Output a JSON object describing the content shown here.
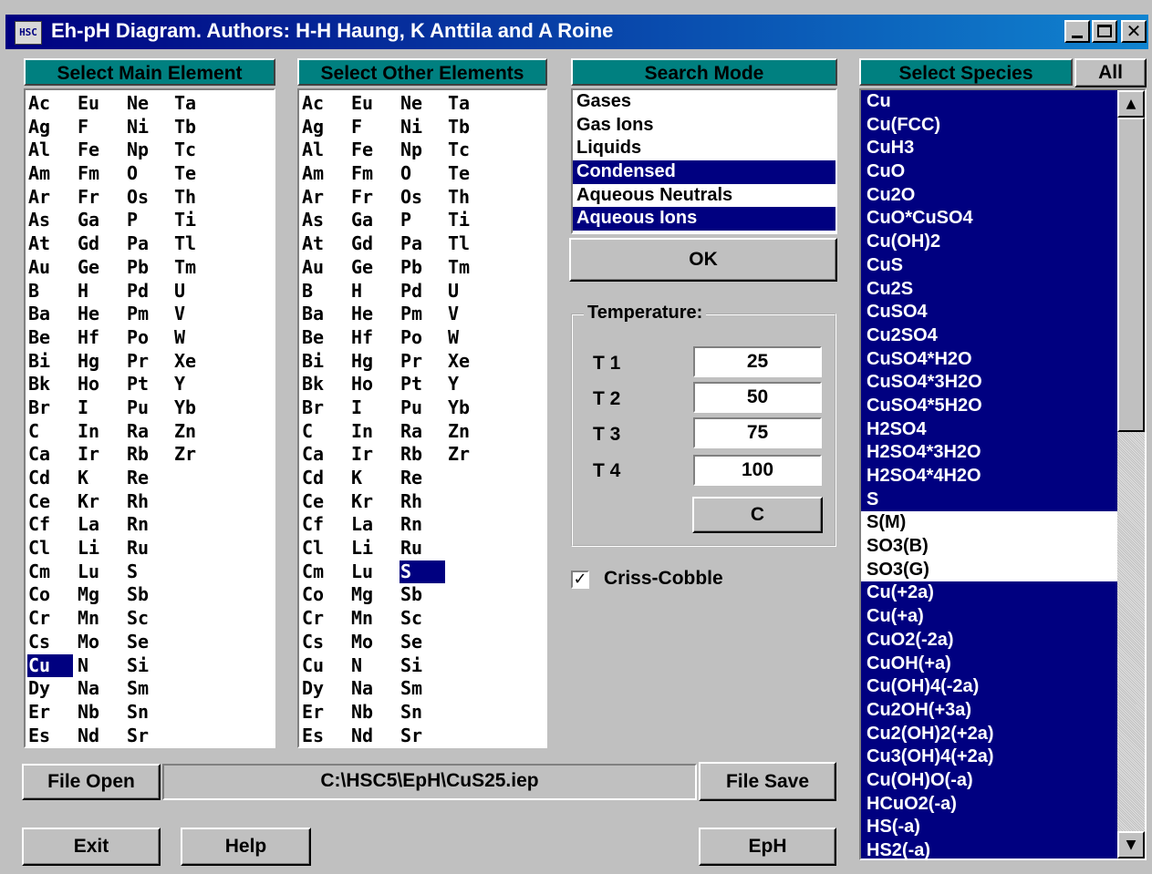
{
  "window": {
    "title": "Eh-pH Diagram. Authors: H-H Haung, K Anttila and A Roine",
    "icon_text": "HSC"
  },
  "headers": {
    "main_element": "Select Main Element",
    "other_elements": "Select Other Elements",
    "search_mode": "Search Mode",
    "species": "Select Species",
    "all_button": "All"
  },
  "elements": {
    "columns": [
      [
        "Ac",
        "Ag",
        "Al",
        "Am",
        "Ar",
        "As",
        "At",
        "Au",
        "B",
        "Ba",
        "Be",
        "Bi",
        "Bk",
        "Br",
        "C",
        "Ca",
        "Cd",
        "Ce",
        "Cf",
        "Cl",
        "Cm",
        "Co",
        "Cr",
        "Cs",
        "Cu",
        "Dy",
        "Er",
        "Es"
      ],
      [
        "Eu",
        "F",
        "Fe",
        "Fm",
        "Fr",
        "Ga",
        "Gd",
        "Ge",
        "H",
        "He",
        "Hf",
        "Hg",
        "Ho",
        "I",
        "In",
        "Ir",
        "K",
        "Kr",
        "La",
        "Li",
        "Lu",
        "Mg",
        "Mn",
        "Mo",
        "N",
        "Na",
        "Nb",
        "Nd"
      ],
      [
        "Ne",
        "Ni",
        "Np",
        "O",
        "Os",
        "P",
        "Pa",
        "Pb",
        "Pd",
        "Pm",
        "Po",
        "Pr",
        "Pt",
        "Pu",
        "Ra",
        "Rb",
        "Re",
        "Rh",
        "Rn",
        "Ru",
        "S",
        "Sb",
        "Sc",
        "Se",
        "Si",
        "Sm",
        "Sn",
        "Sr"
      ],
      [
        "Ta",
        "Tb",
        "Tc",
        "Te",
        "Th",
        "Ti",
        "Tl",
        "Tm",
        "U",
        "V",
        "W",
        "Xe",
        "Y",
        "Yb",
        "Zn",
        "Zr"
      ]
    ],
    "main_selected": "Cu",
    "other_selected": [
      "S"
    ]
  },
  "search_mode": {
    "items": [
      {
        "label": "Gases",
        "selected": false
      },
      {
        "label": "Gas Ions",
        "selected": false
      },
      {
        "label": "Liquids",
        "selected": false
      },
      {
        "label": "Condensed",
        "selected": true
      },
      {
        "label": "Aqueous Neutrals",
        "selected": false
      },
      {
        "label": "Aqueous Ions",
        "selected": true
      }
    ],
    "ok_label": "OK"
  },
  "temperature": {
    "label": "Temperature:",
    "rows": [
      {
        "label": "T 1",
        "value": "25"
      },
      {
        "label": "T 2",
        "value": "50"
      },
      {
        "label": "T 3",
        "value": "75"
      },
      {
        "label": "T 4",
        "value": "100"
      }
    ],
    "unit_button": "C"
  },
  "criss_cobble": {
    "label": "Criss-Cobble",
    "checked": true
  },
  "species": [
    {
      "label": "Cu",
      "selected": true
    },
    {
      "label": "Cu(FCC)",
      "selected": true
    },
    {
      "label": "CuH3",
      "selected": true
    },
    {
      "label": "CuO",
      "selected": true
    },
    {
      "label": "Cu2O",
      "selected": true
    },
    {
      "label": "CuO*CuSO4",
      "selected": true
    },
    {
      "label": "Cu(OH)2",
      "selected": true
    },
    {
      "label": "CuS",
      "selected": true
    },
    {
      "label": "Cu2S",
      "selected": true
    },
    {
      "label": "CuSO4",
      "selected": true
    },
    {
      "label": "Cu2SO4",
      "selected": true
    },
    {
      "label": "CuSO4*H2O",
      "selected": true
    },
    {
      "label": "CuSO4*3H2O",
      "selected": true
    },
    {
      "label": "CuSO4*5H2O",
      "selected": true
    },
    {
      "label": "H2SO4",
      "selected": true
    },
    {
      "label": "H2SO4*3H2O",
      "selected": true
    },
    {
      "label": "H2SO4*4H2O",
      "selected": true
    },
    {
      "label": "S",
      "selected": true
    },
    {
      "label": "S(M)",
      "selected": false
    },
    {
      "label": "SO3(B)",
      "selected": false
    },
    {
      "label": "SO3(G)",
      "selected": false
    },
    {
      "label": "Cu(+2a)",
      "selected": true
    },
    {
      "label": "Cu(+a)",
      "selected": true
    },
    {
      "label": "CuO2(-2a)",
      "selected": true
    },
    {
      "label": "CuOH(+a)",
      "selected": true
    },
    {
      "label": "Cu(OH)4(-2a)",
      "selected": true
    },
    {
      "label": "Cu2OH(+3a)",
      "selected": true
    },
    {
      "label": "Cu2(OH)2(+2a)",
      "selected": true
    },
    {
      "label": "Cu3(OH)4(+2a)",
      "selected": true
    },
    {
      "label": "Cu(OH)O(-a)",
      "selected": true
    },
    {
      "label": "HCuO2(-a)",
      "selected": true
    },
    {
      "label": "HS(-a)",
      "selected": true
    },
    {
      "label": "HS2(-a)",
      "selected": true
    }
  ],
  "file": {
    "open_label": "File Open",
    "path": "C:\\HSC5\\EpH\\CuS25.iep",
    "save_label": "File Save"
  },
  "buttons": {
    "exit": "Exit",
    "help": "Help",
    "eph": "EpH"
  },
  "colors": {
    "header_bg": "#008080",
    "selection_bg": "#000080",
    "face": "#c0c0c0"
  }
}
